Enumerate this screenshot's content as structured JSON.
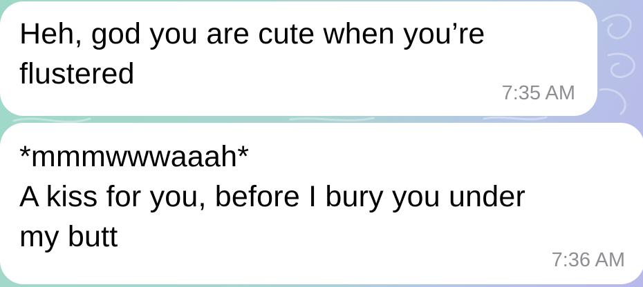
{
  "colors": {
    "bubble_bg": "#ffffff",
    "text": "#000000",
    "timestamp": "#8e8e93",
    "wallpaper_left": "#9fd8c8",
    "wallpaper_right": "#b9b7ea"
  },
  "messages": [
    {
      "lines": [
        "Heh, god you are cute when you’re",
        "flustered"
      ],
      "time": "7:35 AM"
    },
    {
      "lines": [
        "*mmmwwwaaah*",
        "A kiss for you, before I bury you under",
        "my butt"
      ],
      "time": "7:36 AM"
    }
  ]
}
